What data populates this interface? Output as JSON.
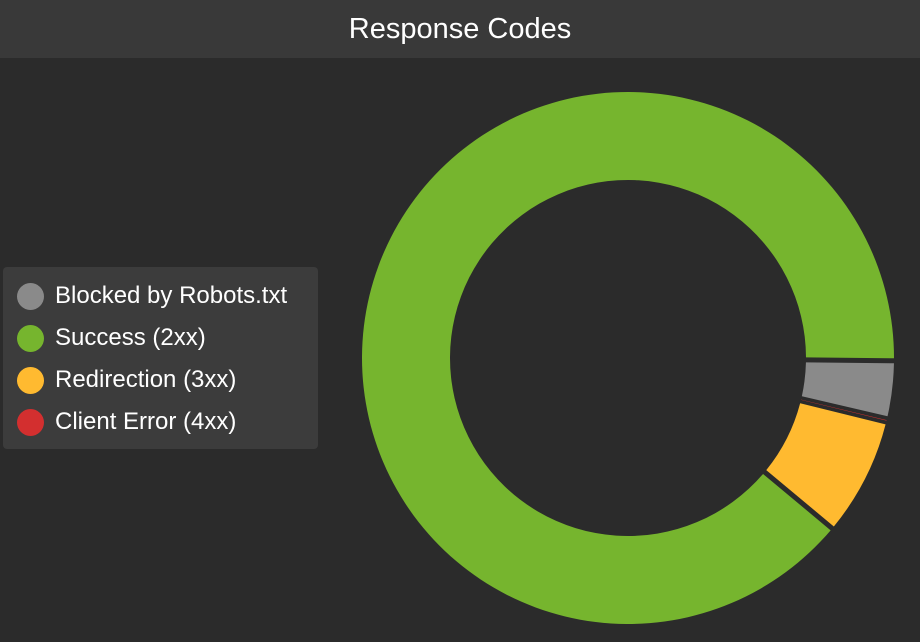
{
  "header": {
    "title": "Response Codes"
  },
  "chart_data": {
    "type": "pie",
    "variant": "donut",
    "title": "Response Codes",
    "legend_position": "left",
    "series": [
      {
        "name": "Blocked by Robots.txt",
        "value": 3.5,
        "color": "#8a8a8a"
      },
      {
        "name": "Success (2xx)",
        "value": 89.1,
        "color": "#76b52e"
      },
      {
        "name": "Redirection (3xx)",
        "value": 7.2,
        "color": "#ffba30"
      },
      {
        "name": "Client Error (4xx)",
        "value": 0.2,
        "color": "#d32f2f"
      }
    ]
  }
}
